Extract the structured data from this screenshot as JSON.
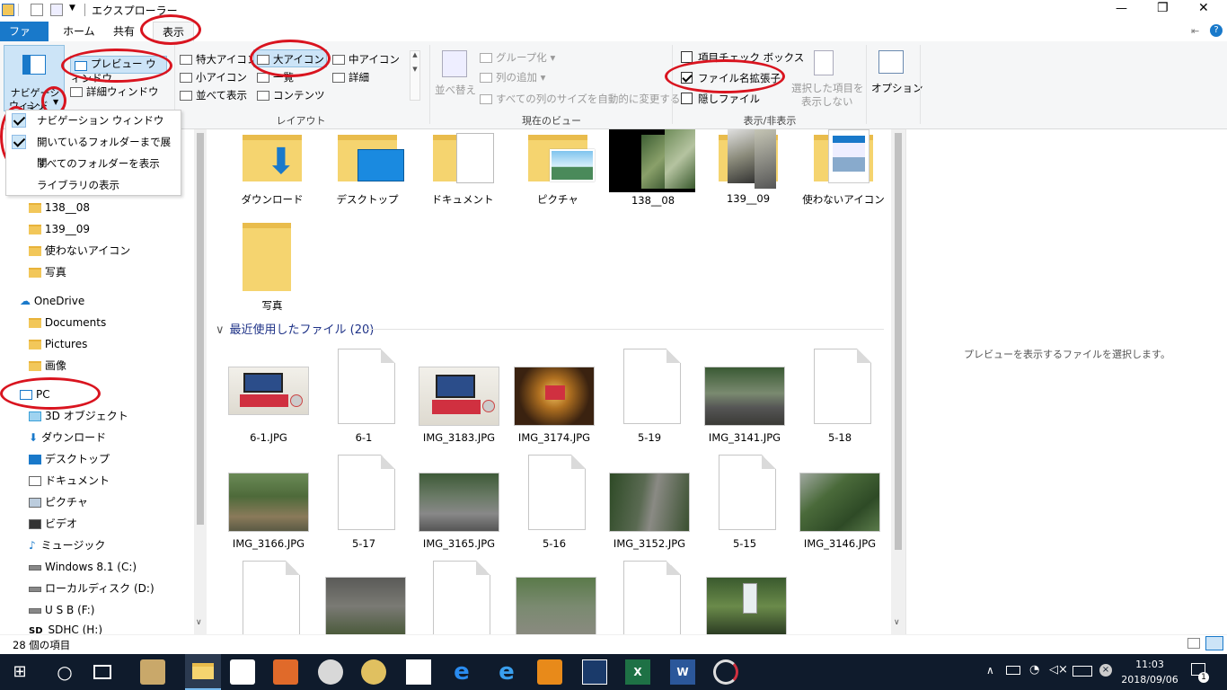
{
  "window": {
    "title": "エクスプローラー",
    "controls": {
      "minimize": "—",
      "maximize": "❐",
      "close": "✕"
    }
  },
  "tabs": [
    "ファイル",
    "ホーム",
    "共有",
    "表示"
  ],
  "ribbon": {
    "pane_group": {
      "nav_pane": "ナビゲーション ウィンドウ",
      "nav_pane_line1": "ナビゲーション",
      "nav_pane_line2": "ウィンドウ",
      "preview_pane": "プレビュー ウィンドウ",
      "details_pane": "詳細ウィンドウ"
    },
    "layout": {
      "title": "レイアウト",
      "extra_large": "特大アイコン",
      "large": "大アイコン",
      "medium": "中アイコン",
      "small": "小アイコン",
      "list": "一覧",
      "details": "詳細",
      "tiles": "並べて表示",
      "content": "コンテンツ"
    },
    "current_view": {
      "title": "現在のビュー",
      "sort": "並べ替え",
      "group_by": "グループ化",
      "add_columns": "列の追加",
      "size_all": "すべての列のサイズを自動的に変更する"
    },
    "show_hide": {
      "title": "表示/非表示",
      "item_checkboxes": "項目チェック ボックス",
      "file_extensions": "ファイル名拡張子",
      "hidden_items": "隠しファイル",
      "hide_selected_line1": "選択した項目を",
      "hide_selected_line2": "表示しない"
    },
    "options": "オプション"
  },
  "dropdown": {
    "items": [
      "ナビゲーション ウィンドウ",
      "開いているフォルダーまで展開",
      "すべてのフォルダーを表示",
      "ライブラリの表示"
    ],
    "checked": [
      true,
      true,
      false,
      false
    ]
  },
  "nav": {
    "folders": [
      "138__08",
      "139__09",
      "使わないアイコン",
      "写真"
    ],
    "onedrive": "OneDrive",
    "onedrive_items": [
      "Documents",
      "Pictures",
      "画像"
    ],
    "pc": "PC",
    "pc_items": [
      "3D オブジェクト",
      "ダウンロード",
      "デスクトップ",
      "ドキュメント",
      "ピクチャ",
      "ビデオ",
      "ミュージック",
      "Windows 8.1 (C:)",
      "ローカルディスク (D:)",
      "U S B (F:)",
      "SDHC (H:)"
    ]
  },
  "content": {
    "folders_row": [
      "ダウンロード",
      "デスクトップ",
      "ドキュメント",
      "ピクチャ",
      "138__08",
      "139__09",
      "使わないアイコン"
    ],
    "folders_row2": [
      "写真"
    ],
    "recent_header": "最近使用したファイル (20)",
    "recent_row1": [
      "6-1.JPG",
      "6-1",
      "IMG_3183.JPG",
      "IMG_3174.JPG",
      "5-19",
      "IMG_3141.JPG",
      "5-18"
    ],
    "recent_row2": [
      "IMG_3166.JPG",
      "5-17",
      "IMG_3165.JPG",
      "5-16",
      "IMG_3152.JPG",
      "5-15",
      "IMG_3146.JPG"
    ]
  },
  "preview": {
    "message": "プレビューを表示するファイルを選択します。"
  },
  "status": {
    "count": "28 個の項目"
  },
  "taskbar": {
    "time": "11:03",
    "date": "2018/09/06",
    "notif_count": "1"
  }
}
